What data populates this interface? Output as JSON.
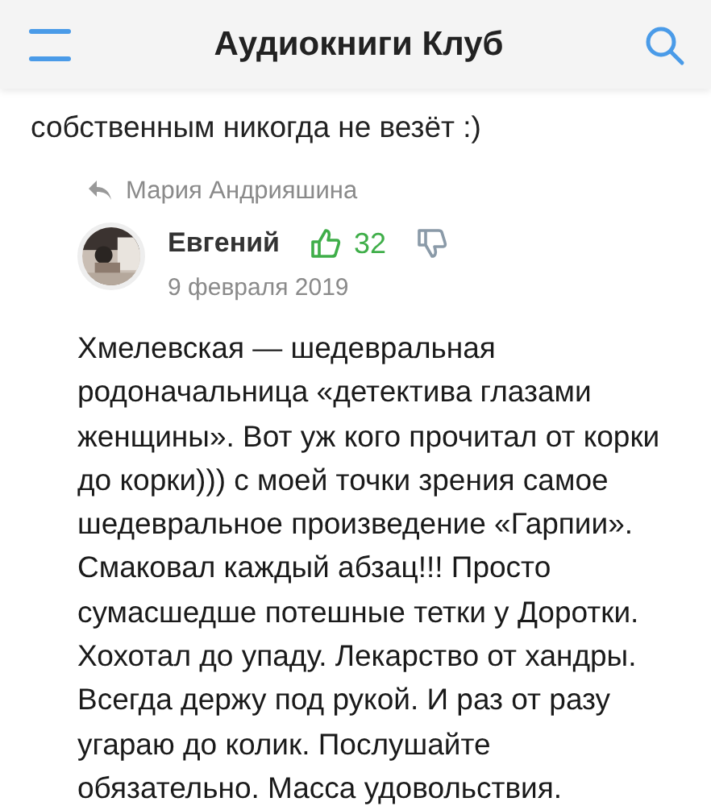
{
  "header": {
    "title": "Аудиокниги Клуб"
  },
  "previous_comment": {
    "text_tail": "собственным никогда не везёт :)"
  },
  "reply": {
    "reply_to": "Мария Андрияшина",
    "author": "Евгений",
    "likes": "32",
    "liked": true,
    "disliked": false,
    "date": "9 февраля 2019",
    "text": "Хмелевская — шедевральная родоначальница «детектива глазами женщины». Вот уж кого прочитал от корки до корки))) с моей точки зрения самое шедевральное произведение «Гарпии». Смаковал каждый абзац!!! Просто сумасшедше потешные тетки у Доротки. Хохотал до упаду. Лекарство от хандры. Всегда держу под рукой. И раз от разу угараю до колик. Послушайте обязательно. Масса удовольствия."
  }
}
